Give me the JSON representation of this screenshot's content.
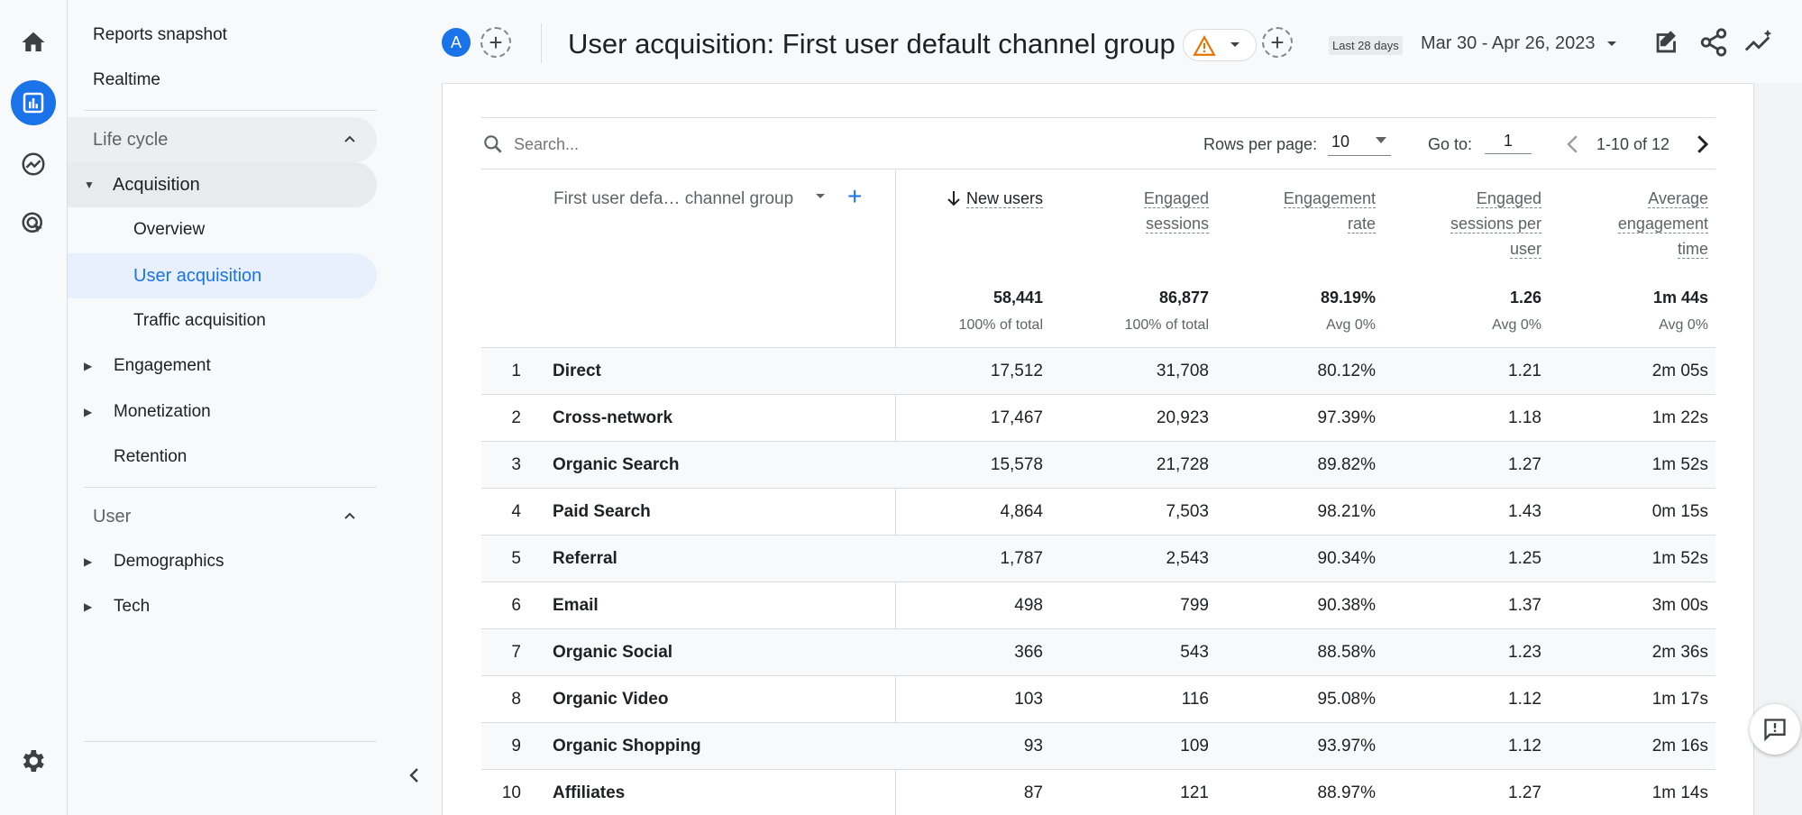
{
  "colors": {
    "accent": "#1a73e8",
    "active_nav_bg": "#e8f0fe",
    "section_bg": "#e8eaed",
    "warning": "#e37400"
  },
  "rail": {
    "icons": [
      "home-icon",
      "reports-icon",
      "explore-icon",
      "advertising-icon",
      "settings-icon"
    ],
    "active": "reports-icon"
  },
  "sidenav": {
    "top_links": [
      "Reports snapshot",
      "Realtime"
    ],
    "lifecycle": {
      "title": "Life cycle",
      "acquisition": {
        "label": "Acquisition",
        "children": [
          "Overview",
          "User acquisition",
          "Traffic acquisition"
        ],
        "active_child": "User acquisition"
      },
      "items": [
        "Engagement",
        "Monetization",
        "Retention"
      ]
    },
    "user": {
      "title": "User",
      "items": [
        "Demographics",
        "Tech"
      ]
    }
  },
  "header": {
    "avatar_letter": "A",
    "add_comparison": "+",
    "title": "User acquisition: First user default channel group",
    "date_badge": "Last 28 days",
    "date_range": "Mar 30 - Apr 26, 2023"
  },
  "toolbar": {
    "search_placeholder": "Search...",
    "rows_per_page_label": "Rows per page:",
    "rows_per_page_value": "10",
    "goto_label": "Go to:",
    "goto_value": "1",
    "pagination": "1-10 of 12"
  },
  "table": {
    "dimension_header": "First user defa… channel group",
    "add_dimension": "+",
    "metric_headers": [
      [
        "New users"
      ],
      [
        "Engaged",
        "sessions"
      ],
      [
        "Engagement",
        "rate"
      ],
      [
        "Engaged",
        "sessions per",
        "user"
      ],
      [
        "Average",
        "engagement",
        "time"
      ]
    ],
    "totals": [
      "58,441",
      "86,877",
      "89.19%",
      "1.26",
      "1m 44s"
    ],
    "totals_sub": [
      "100% of total",
      "100% of total",
      "Avg 0%",
      "Avg 0%",
      "Avg 0%"
    ],
    "rows": [
      {
        "n": "1",
        "channel": "Direct",
        "values": [
          "17,512",
          "31,708",
          "80.12%",
          "1.21",
          "2m 05s"
        ]
      },
      {
        "n": "2",
        "channel": "Cross-network",
        "values": [
          "17,467",
          "20,923",
          "97.39%",
          "1.18",
          "1m 22s"
        ]
      },
      {
        "n": "3",
        "channel": "Organic Search",
        "values": [
          "15,578",
          "21,728",
          "89.82%",
          "1.27",
          "1m 52s"
        ]
      },
      {
        "n": "4",
        "channel": "Paid Search",
        "values": [
          "4,864",
          "7,503",
          "98.21%",
          "1.43",
          "0m 15s"
        ]
      },
      {
        "n": "5",
        "channel": "Referral",
        "values": [
          "1,787",
          "2,543",
          "90.34%",
          "1.25",
          "1m 52s"
        ]
      },
      {
        "n": "6",
        "channel": "Email",
        "values": [
          "498",
          "799",
          "90.38%",
          "1.37",
          "3m 00s"
        ]
      },
      {
        "n": "7",
        "channel": "Organic Social",
        "values": [
          "366",
          "543",
          "88.58%",
          "1.23",
          "2m 36s"
        ]
      },
      {
        "n": "8",
        "channel": "Organic Video",
        "values": [
          "103",
          "116",
          "95.08%",
          "1.12",
          "1m 17s"
        ]
      },
      {
        "n": "9",
        "channel": "Organic Shopping",
        "values": [
          "93",
          "109",
          "93.97%",
          "1.12",
          "2m 16s"
        ]
      },
      {
        "n": "10",
        "channel": "Affiliates",
        "values": [
          "87",
          "121",
          "88.97%",
          "1.27",
          "1m 14s"
        ]
      }
    ]
  }
}
